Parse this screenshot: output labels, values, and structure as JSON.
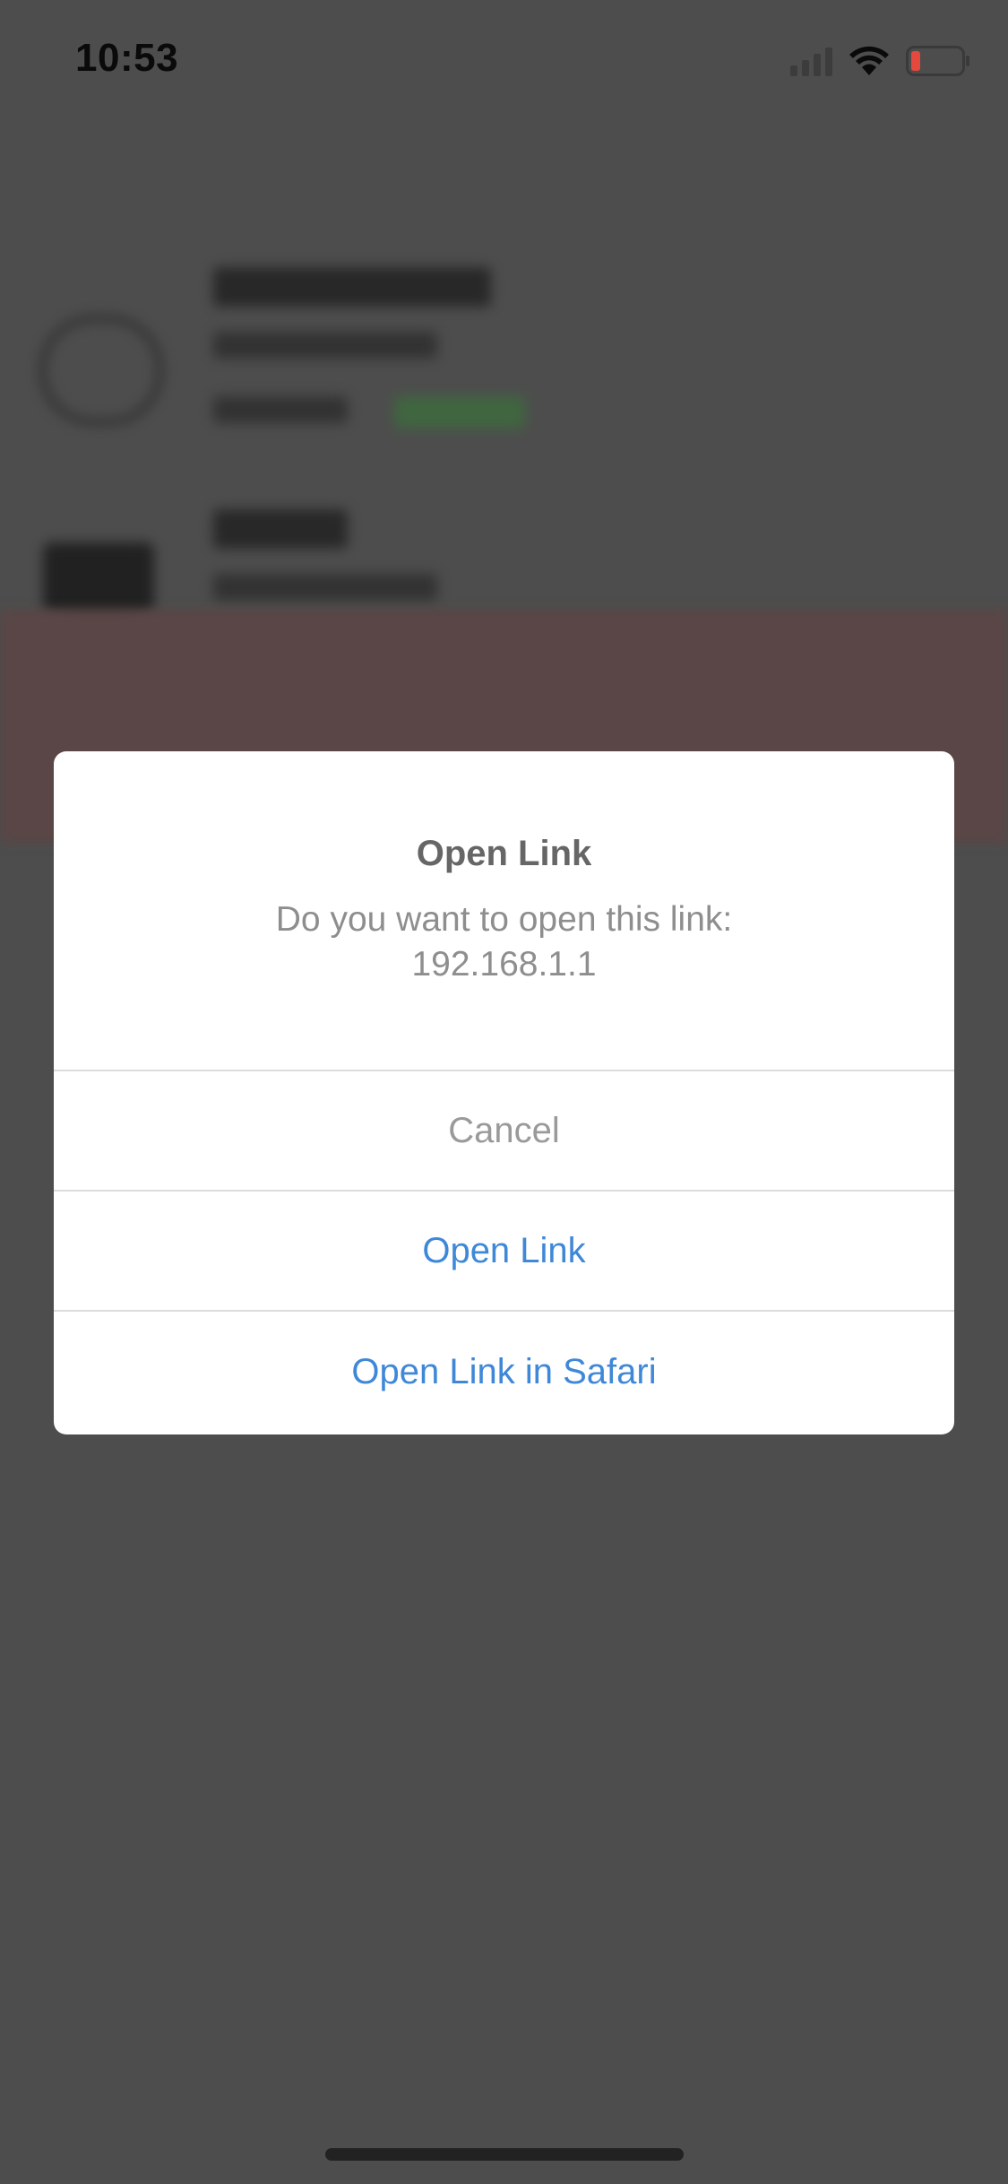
{
  "status_bar": {
    "time": "10:53",
    "icons": [
      "cellular-signal-icon",
      "wifi-icon",
      "battery-low-icon"
    ],
    "battery_color": "#e5483c"
  },
  "alert": {
    "title": "Open Link",
    "message": "Do you want to open this link:\n192.168.1.1",
    "buttons": {
      "cancel": "Cancel",
      "open_link": "Open Link",
      "open_in_safari": "Open Link in Safari"
    }
  },
  "colors": {
    "overlay": "#4d4d4d",
    "link_blue": "#3f88d8",
    "cancel_gray": "#9a9a9a"
  }
}
